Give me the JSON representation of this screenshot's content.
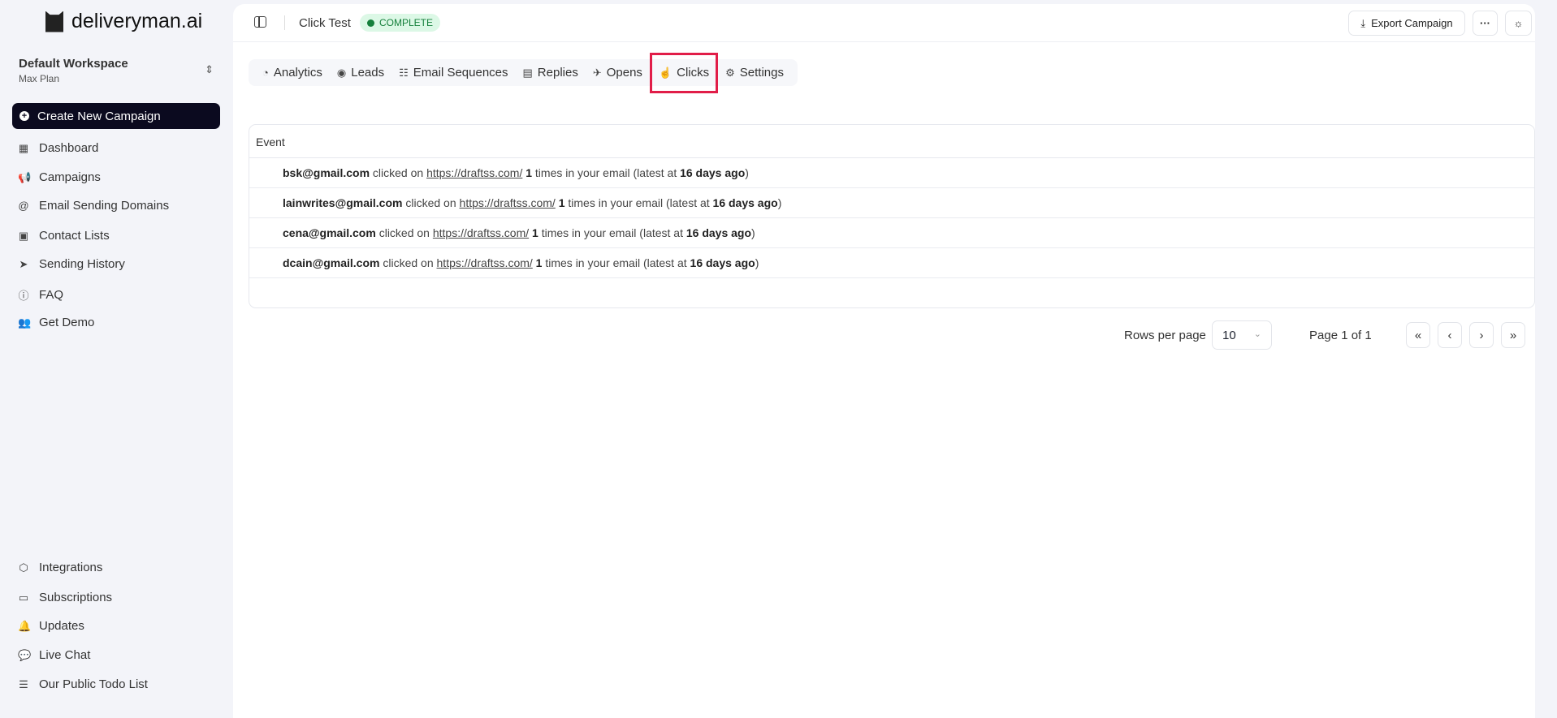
{
  "brand": {
    "name": "deliveryman.ai"
  },
  "workspace": {
    "name": "Default Workspace",
    "plan": "Max Plan"
  },
  "sidebar": {
    "create_label": "Create New Campaign",
    "items": [
      {
        "label": "Dashboard",
        "icon": "dashboard-icon",
        "glyph": "▦"
      },
      {
        "label": "Campaigns",
        "icon": "megaphone-icon",
        "glyph": "📢"
      },
      {
        "label": "Email Sending Domains",
        "icon": "at-icon",
        "glyph": "@"
      },
      {
        "label": "Contact Lists",
        "icon": "contact-book-icon",
        "glyph": "▣"
      },
      {
        "label": "Sending History",
        "icon": "send-icon",
        "glyph": "➤"
      },
      {
        "label": "FAQ",
        "icon": "info-icon",
        "glyph": "ⓘ"
      },
      {
        "label": "Get Demo",
        "icon": "users-icon",
        "glyph": "👥"
      }
    ],
    "bottom_items": [
      {
        "label": "Integrations",
        "icon": "box-icon",
        "glyph": "⬡"
      },
      {
        "label": "Subscriptions",
        "icon": "card-icon",
        "glyph": "▭"
      },
      {
        "label": "Updates",
        "icon": "bell-icon",
        "glyph": "🔔"
      },
      {
        "label": "Live Chat",
        "icon": "chat-icon",
        "glyph": "💬"
      },
      {
        "label": "Our Public Todo List",
        "icon": "list-icon",
        "glyph": "☰"
      }
    ]
  },
  "header": {
    "title": "Click Test",
    "status": "COMPLETE",
    "export_label": "Export Campaign"
  },
  "tabs": [
    {
      "label": "Analytics",
      "glyph": "◔"
    },
    {
      "label": "Leads",
      "glyph": "◉"
    },
    {
      "label": "Email Sequences",
      "glyph": "☷"
    },
    {
      "label": "Replies",
      "glyph": "▤"
    },
    {
      "label": "Opens",
      "glyph": "✈"
    },
    {
      "label": "Clicks",
      "glyph": "☝"
    },
    {
      "label": "Settings",
      "glyph": "⚙"
    }
  ],
  "table": {
    "header": "Event",
    "rows": [
      {
        "email": "bsk@gmail.com",
        "mid": " clicked on ",
        "url": "https://draftss.com/",
        "count": "1",
        "tail": " times in your email (latest at ",
        "when": "16 days ago",
        "end": ")"
      },
      {
        "email": "lainwrites@gmail.com",
        "mid": " clicked on ",
        "url": "https://draftss.com/",
        "count": "1",
        "tail": " times in your email (latest at ",
        "when": "16 days ago",
        "end": ")"
      },
      {
        "email": "cena@gmail.com",
        "mid": " clicked on ",
        "url": "https://draftss.com/",
        "count": "1",
        "tail": " times in your email (latest at ",
        "when": "16 days ago",
        "end": ")"
      },
      {
        "email": "dcain@gmail.com",
        "mid": " clicked on ",
        "url": "https://draftss.com/",
        "count": "1",
        "tail": " times in your email (latest at ",
        "when": "16 days ago",
        "end": ")"
      }
    ]
  },
  "pagination": {
    "rows_per_page_label": "Rows per page",
    "rows_per_page": "10",
    "page_label": "Page 1 of 1",
    "first": "«",
    "prev": "‹",
    "next": "›",
    "last": "»"
  }
}
